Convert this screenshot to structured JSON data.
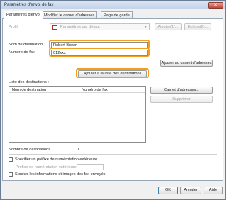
{
  "window": {
    "title": "Paramètres d'envoi de fax",
    "close_glyph": "✕"
  },
  "tabs": [
    {
      "label": "Paramètres d'envoi"
    },
    {
      "label": "Modifier le carnet d'adresses"
    },
    {
      "label": "Page de garde"
    }
  ],
  "profile": {
    "label": "Profil",
    "value": "Paramètres par défaut",
    "add_button": "Ajouter(1)...",
    "edit_button": "Edition(2)..."
  },
  "recipient": {
    "name_label": "Nom de destination",
    "name_value": "Robert Brown",
    "fax_label": "Numéro de fax",
    "fax_value": "012xxx",
    "add_to_address_book_button": "Ajouter au carnet d'adresses",
    "add_to_list_button": "Ajouter à la liste des destinations"
  },
  "destinations": {
    "list_label": "Liste des destinations :",
    "columns": [
      "Nom de destination",
      "Numéro de fax"
    ],
    "rows": [],
    "address_book_button": "Carnet d'adresses...",
    "delete_button": "Supprimer",
    "count_label": "Nombre de destinations :",
    "count_value": "0"
  },
  "options": {
    "prefix_checkbox_label": "Spécifier un préfixe de numérotation extérieure",
    "prefix_field_label": "Préfixe de numérotation extérieure",
    "prefix_value": "",
    "store_checkbox_label": "Stocker les informations et images des fax envoyés"
  },
  "footer": {
    "ok": "OK",
    "cancel": "Annuler",
    "help": "Aide"
  },
  "colors": {
    "highlight": "#f0a020",
    "accent": "#c2473a"
  }
}
